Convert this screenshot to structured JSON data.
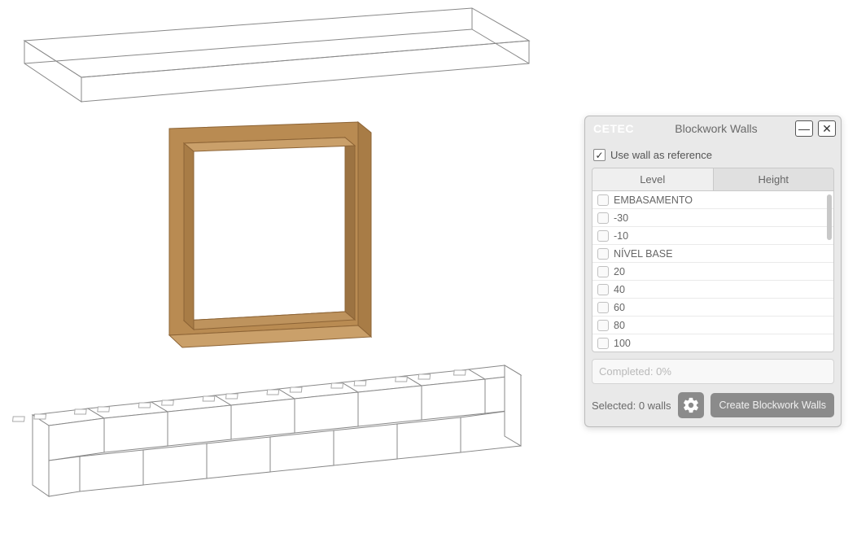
{
  "dialog": {
    "logo": "CETEC",
    "title": "Blockwork Walls",
    "minimize": "—",
    "close": "✕",
    "use_wall_reference_label": "Use wall as reference",
    "use_wall_reference_checked": true,
    "tabs": {
      "level": "Level",
      "height": "Height",
      "active": "level"
    },
    "levels": [
      {
        "label": "EMBASAMENTO",
        "checked": false
      },
      {
        "label": "-30",
        "checked": false
      },
      {
        "label": "-10",
        "checked": false
      },
      {
        "label": "NÍVEL BASE",
        "checked": false
      },
      {
        "label": "20",
        "checked": false
      },
      {
        "label": "40",
        "checked": false
      },
      {
        "label": "60",
        "checked": false
      },
      {
        "label": "80",
        "checked": false
      },
      {
        "label": "100",
        "checked": false
      }
    ],
    "progress_text": "Completed: 0%",
    "selected_text": "Selected: 0 walls",
    "create_button": "Create Blockwork Walls"
  },
  "colors": {
    "panel_bg": "#e9e9e9",
    "accent_button": "#8b8b8b",
    "wood": "#b98b52",
    "wood_dark": "#8d6436",
    "line": "#888888"
  }
}
